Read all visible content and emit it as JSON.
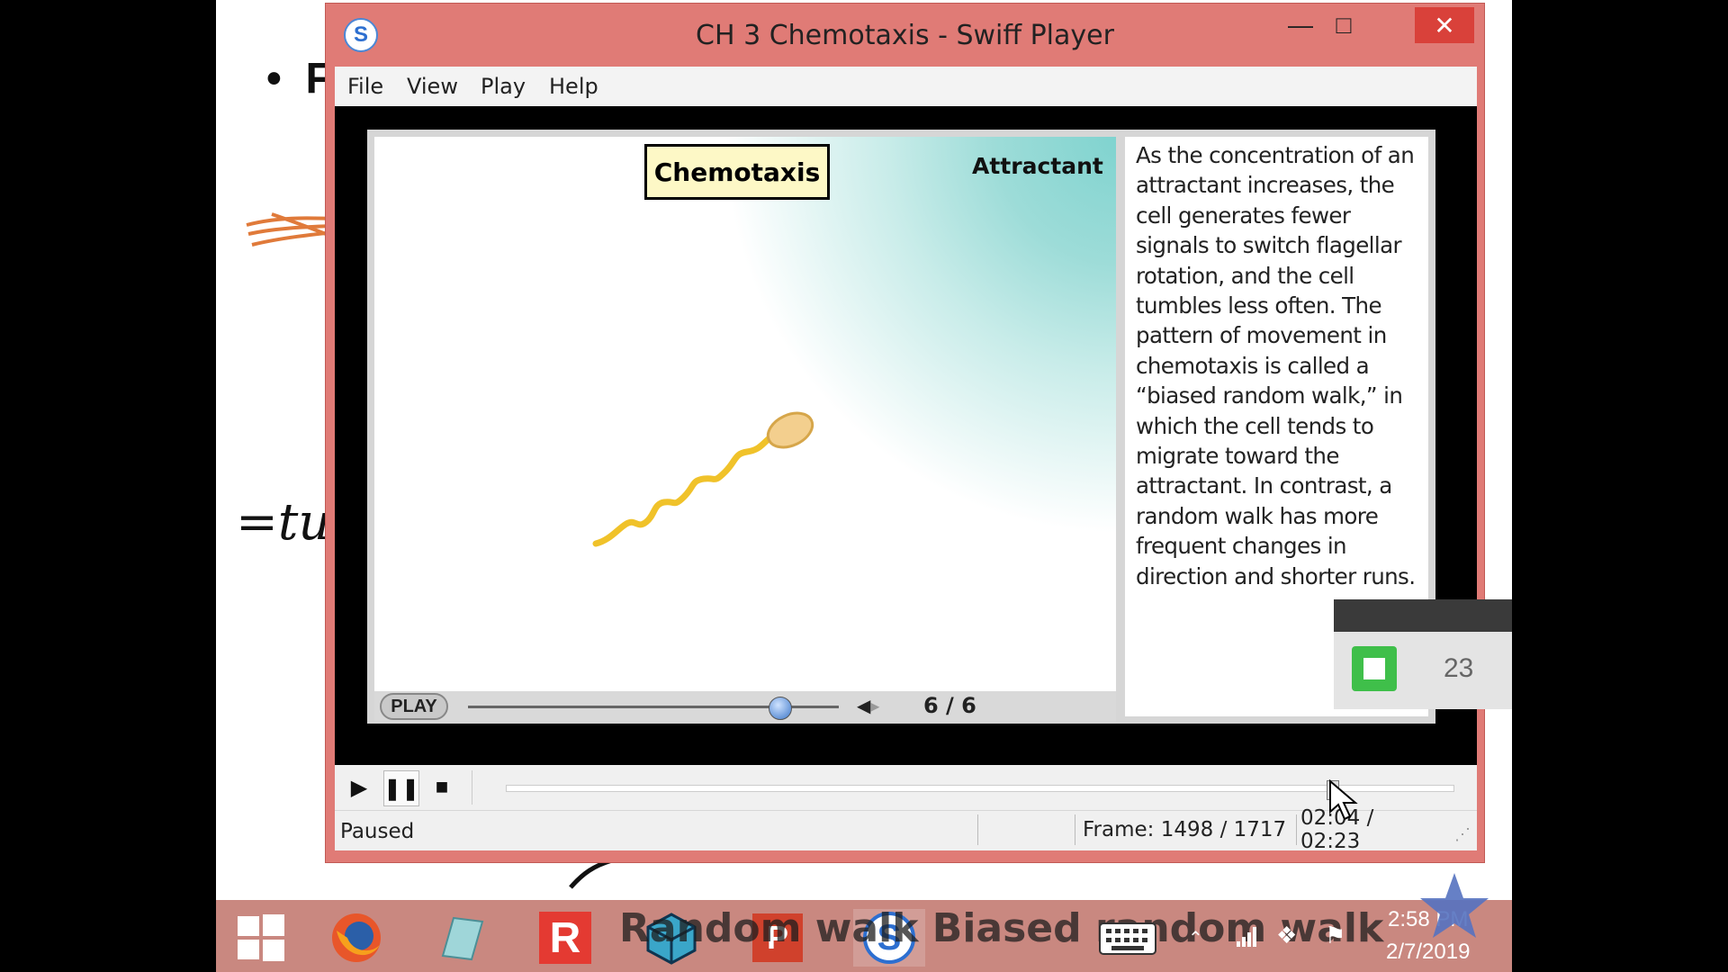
{
  "background": {
    "bullet_text": "F",
    "handwritten_text": "=tu"
  },
  "window": {
    "title": "CH 3 Chemotaxis - Swiff Player",
    "controls": {
      "minimize": "—",
      "maximize": "□",
      "close": "✕"
    },
    "menu": [
      "File",
      "View",
      "Play",
      "Help"
    ]
  },
  "movie": {
    "title_box": "Chemotaxis",
    "attractant_label": "Attractant",
    "description": "As the concentration of an attractant increases, the cell generates fewer signals to switch flagellar rotation, and the cell tumbles less often. The pattern of movement in chemotaxis is called a “biased random walk,” in which the cell tends to migrate toward the attractant. In contrast, a random walk has more frequent changes in direction and shorter runs.",
    "play_label": "PLAY",
    "page_indicator": "6 / 6",
    "scrubber_fraction": 0.84
  },
  "transport": {
    "play": "play-icon",
    "pause": "pause-icon",
    "stop": "stop-icon",
    "seek_fraction": 0.872
  },
  "status": {
    "state": "Paused",
    "frame": "Frame: 1498 / 1717",
    "time": "02:04 / 02:23"
  },
  "widget": {
    "count": "23"
  },
  "taskbar": {
    "overlay_text": "Random walk    Biased random walk",
    "time": "2:58 PM",
    "date": "2/7/2019"
  },
  "colors": {
    "window_frame": "#e07b76",
    "close_button": "#d9413a",
    "title_box_fill": "#fdf8c6",
    "attractant_gradient": "#7fd3cf",
    "taskbar": "#c98880"
  }
}
